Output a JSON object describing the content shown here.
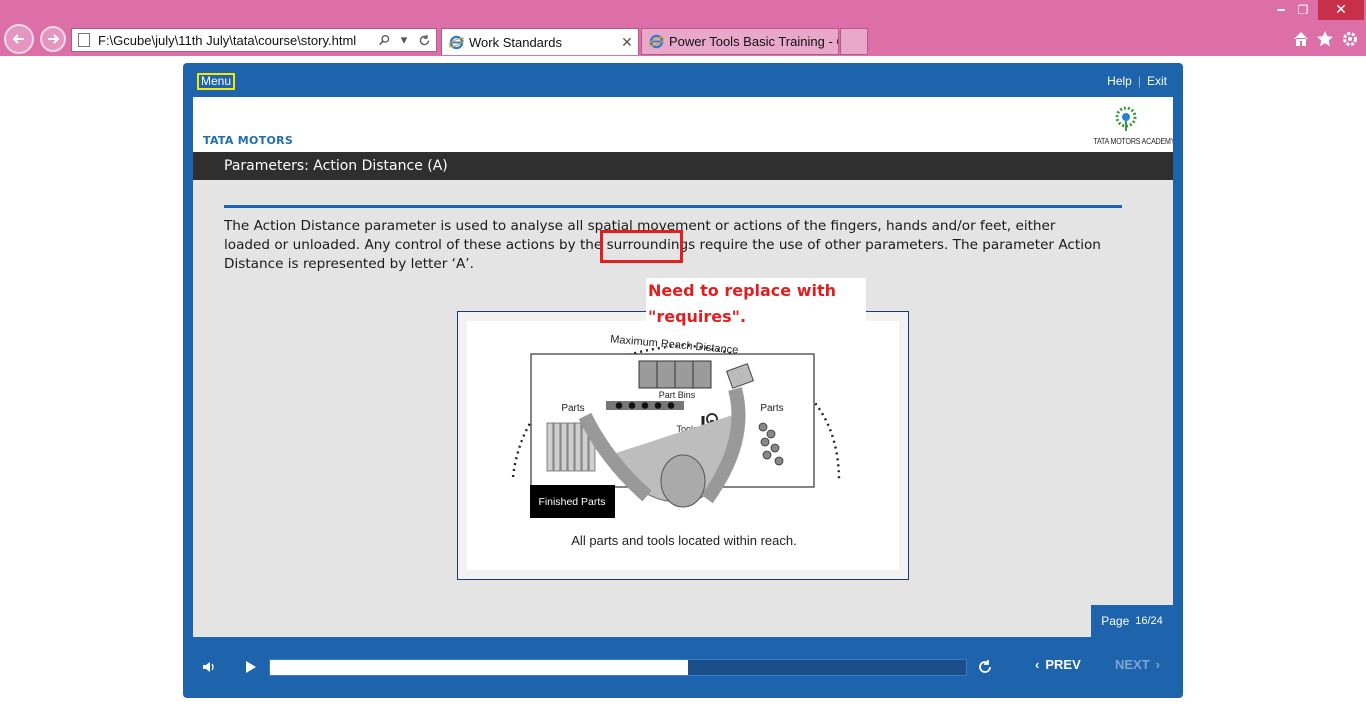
{
  "browser": {
    "address": "F:\\Gcube\\july\\11th July\\tata\\course\\story.html",
    "tabs": [
      {
        "label": "Work Standards",
        "active": true
      },
      {
        "label": "Power Tools Basic Training - C...",
        "active": false
      }
    ],
    "accent": "#dc6fa8"
  },
  "player": {
    "menu_label": "Menu",
    "help_label": "Help",
    "exit_label": "Exit",
    "brand_left": "TATA MOTORS",
    "brand_right": "TATA MOTORS ACADEMY",
    "title": "Parameters: Action Distance (A)",
    "body": "The Action Distance parameter is used to analyse all spatial movement or actions of the fingers, hands and/or feet, either loaded or unloaded. Any control of these actions by the surroundings require the use of other parameters. The parameter Action Distance is represented by letter ‘A’.",
    "callout": "Need to replace with \"requires\".",
    "diagram": {
      "arc_label": "Maximum Reach Distance",
      "bins_label": "Part Bins",
      "parts_left": "Parts",
      "parts_right": "Parts",
      "tools_label": "Tools",
      "finished_label": "Finished Parts",
      "caption": "All parts and tools located within reach."
    },
    "page_label": "Page",
    "page_num": "16/24",
    "progress_fraction": 0.6,
    "prev_label": "PREV",
    "next_label": "NEXT",
    "frame_color": "#1d64ad",
    "highlight_color": "#e02020"
  }
}
